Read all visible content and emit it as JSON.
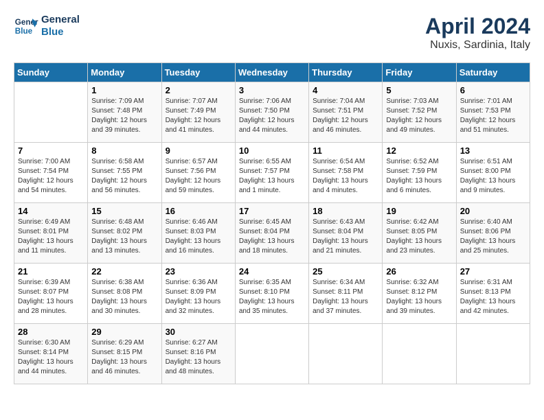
{
  "header": {
    "logo_line1": "General",
    "logo_line2": "Blue",
    "month_title": "April 2024",
    "location": "Nuxis, Sardinia, Italy"
  },
  "weekdays": [
    "Sunday",
    "Monday",
    "Tuesday",
    "Wednesday",
    "Thursday",
    "Friday",
    "Saturday"
  ],
  "weeks": [
    [
      {
        "day": "",
        "info": ""
      },
      {
        "day": "1",
        "info": "Sunrise: 7:09 AM\nSunset: 7:48 PM\nDaylight: 12 hours\nand 39 minutes."
      },
      {
        "day": "2",
        "info": "Sunrise: 7:07 AM\nSunset: 7:49 PM\nDaylight: 12 hours\nand 41 minutes."
      },
      {
        "day": "3",
        "info": "Sunrise: 7:06 AM\nSunset: 7:50 PM\nDaylight: 12 hours\nand 44 minutes."
      },
      {
        "day": "4",
        "info": "Sunrise: 7:04 AM\nSunset: 7:51 PM\nDaylight: 12 hours\nand 46 minutes."
      },
      {
        "day": "5",
        "info": "Sunrise: 7:03 AM\nSunset: 7:52 PM\nDaylight: 12 hours\nand 49 minutes."
      },
      {
        "day": "6",
        "info": "Sunrise: 7:01 AM\nSunset: 7:53 PM\nDaylight: 12 hours\nand 51 minutes."
      }
    ],
    [
      {
        "day": "7",
        "info": "Sunrise: 7:00 AM\nSunset: 7:54 PM\nDaylight: 12 hours\nand 54 minutes."
      },
      {
        "day": "8",
        "info": "Sunrise: 6:58 AM\nSunset: 7:55 PM\nDaylight: 12 hours\nand 56 minutes."
      },
      {
        "day": "9",
        "info": "Sunrise: 6:57 AM\nSunset: 7:56 PM\nDaylight: 12 hours\nand 59 minutes."
      },
      {
        "day": "10",
        "info": "Sunrise: 6:55 AM\nSunset: 7:57 PM\nDaylight: 13 hours\nand 1 minute."
      },
      {
        "day": "11",
        "info": "Sunrise: 6:54 AM\nSunset: 7:58 PM\nDaylight: 13 hours\nand 4 minutes."
      },
      {
        "day": "12",
        "info": "Sunrise: 6:52 AM\nSunset: 7:59 PM\nDaylight: 13 hours\nand 6 minutes."
      },
      {
        "day": "13",
        "info": "Sunrise: 6:51 AM\nSunset: 8:00 PM\nDaylight: 13 hours\nand 9 minutes."
      }
    ],
    [
      {
        "day": "14",
        "info": "Sunrise: 6:49 AM\nSunset: 8:01 PM\nDaylight: 13 hours\nand 11 minutes."
      },
      {
        "day": "15",
        "info": "Sunrise: 6:48 AM\nSunset: 8:02 PM\nDaylight: 13 hours\nand 13 minutes."
      },
      {
        "day": "16",
        "info": "Sunrise: 6:46 AM\nSunset: 8:03 PM\nDaylight: 13 hours\nand 16 minutes."
      },
      {
        "day": "17",
        "info": "Sunrise: 6:45 AM\nSunset: 8:04 PM\nDaylight: 13 hours\nand 18 minutes."
      },
      {
        "day": "18",
        "info": "Sunrise: 6:43 AM\nSunset: 8:04 PM\nDaylight: 13 hours\nand 21 minutes."
      },
      {
        "day": "19",
        "info": "Sunrise: 6:42 AM\nSunset: 8:05 PM\nDaylight: 13 hours\nand 23 minutes."
      },
      {
        "day": "20",
        "info": "Sunrise: 6:40 AM\nSunset: 8:06 PM\nDaylight: 13 hours\nand 25 minutes."
      }
    ],
    [
      {
        "day": "21",
        "info": "Sunrise: 6:39 AM\nSunset: 8:07 PM\nDaylight: 13 hours\nand 28 minutes."
      },
      {
        "day": "22",
        "info": "Sunrise: 6:38 AM\nSunset: 8:08 PM\nDaylight: 13 hours\nand 30 minutes."
      },
      {
        "day": "23",
        "info": "Sunrise: 6:36 AM\nSunset: 8:09 PM\nDaylight: 13 hours\nand 32 minutes."
      },
      {
        "day": "24",
        "info": "Sunrise: 6:35 AM\nSunset: 8:10 PM\nDaylight: 13 hours\nand 35 minutes."
      },
      {
        "day": "25",
        "info": "Sunrise: 6:34 AM\nSunset: 8:11 PM\nDaylight: 13 hours\nand 37 minutes."
      },
      {
        "day": "26",
        "info": "Sunrise: 6:32 AM\nSunset: 8:12 PM\nDaylight: 13 hours\nand 39 minutes."
      },
      {
        "day": "27",
        "info": "Sunrise: 6:31 AM\nSunset: 8:13 PM\nDaylight: 13 hours\nand 42 minutes."
      }
    ],
    [
      {
        "day": "28",
        "info": "Sunrise: 6:30 AM\nSunset: 8:14 PM\nDaylight: 13 hours\nand 44 minutes."
      },
      {
        "day": "29",
        "info": "Sunrise: 6:29 AM\nSunset: 8:15 PM\nDaylight: 13 hours\nand 46 minutes."
      },
      {
        "day": "30",
        "info": "Sunrise: 6:27 AM\nSunset: 8:16 PM\nDaylight: 13 hours\nand 48 minutes."
      },
      {
        "day": "",
        "info": ""
      },
      {
        "day": "",
        "info": ""
      },
      {
        "day": "",
        "info": ""
      },
      {
        "day": "",
        "info": ""
      }
    ]
  ]
}
